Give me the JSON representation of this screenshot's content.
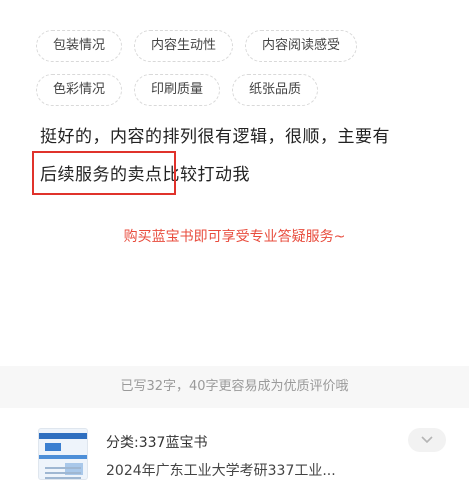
{
  "tags": {
    "row1": [
      "包装情况",
      "内容生动性",
      "内容阅读感受"
    ],
    "row2": [
      "色彩情况",
      "印刷质量",
      "纸张品质"
    ]
  },
  "review": {
    "line1": "挺好的，内容的排列很有逻辑，很顺，主要有",
    "line2": "后续服务的卖点比较打动我"
  },
  "promo": {
    "text": "购买蓝宝书即可享受专业答疑服务~"
  },
  "hint": {
    "text": "已写32字，40字更容易成为优质评价哦"
  },
  "product": {
    "category": "分类:337蓝宝书",
    "title": "2024年广东工业大学考研337工业..."
  },
  "icons": {
    "toggle": "chevron-down-icon",
    "thumbnail": "book-cover-thumbnail"
  },
  "colors": {
    "highlight": "#e0322b",
    "promo": "#e84c3d",
    "hint_bg": "#f7f7f7"
  }
}
